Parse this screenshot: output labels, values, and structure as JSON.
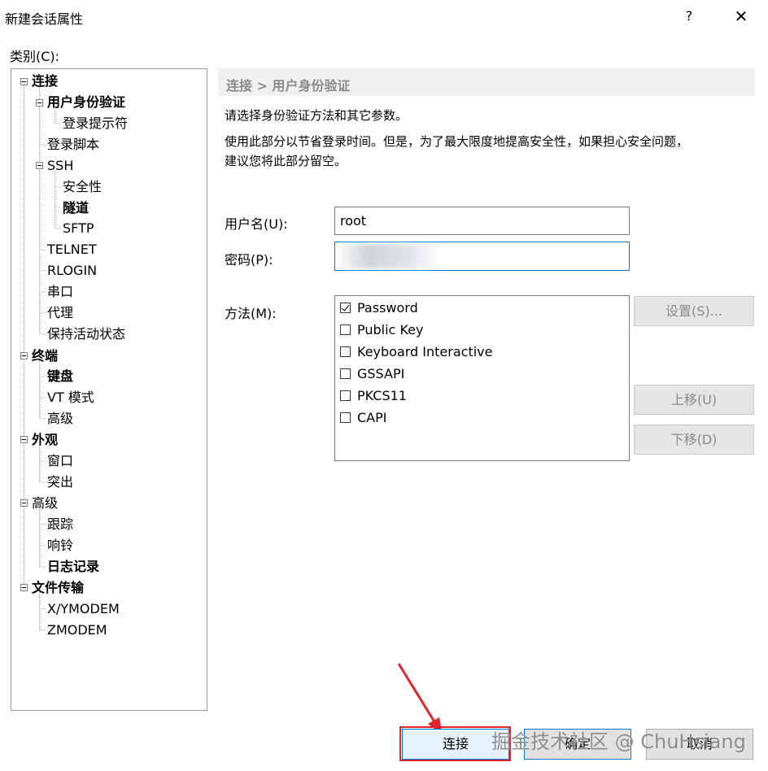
{
  "window": {
    "title": "新建会话属性",
    "help_label": "?",
    "close_label": "✕"
  },
  "category_label": "类别(C):",
  "tree": {
    "items": [
      {
        "label": "连接",
        "bold": true
      },
      {
        "label": "用户身份验证",
        "bold": true
      },
      {
        "label": "登录提示符",
        "bold": false
      },
      {
        "label": "登录脚本",
        "bold": false
      },
      {
        "label": "SSH",
        "bold": false
      },
      {
        "label": "安全性",
        "bold": false
      },
      {
        "label": "隧道",
        "bold": true
      },
      {
        "label": "SFTP",
        "bold": false
      },
      {
        "label": "TELNET",
        "bold": false
      },
      {
        "label": "RLOGIN",
        "bold": false
      },
      {
        "label": "串口",
        "bold": false
      },
      {
        "label": "代理",
        "bold": false
      },
      {
        "label": "保持活动状态",
        "bold": false
      },
      {
        "label": "终端",
        "bold": true
      },
      {
        "label": "键盘",
        "bold": true
      },
      {
        "label": "VT 模式",
        "bold": false
      },
      {
        "label": "高级",
        "bold": false
      },
      {
        "label": "外观",
        "bold": true
      },
      {
        "label": "窗口",
        "bold": false
      },
      {
        "label": "突出",
        "bold": false
      },
      {
        "label": "高级",
        "bold": false
      },
      {
        "label": "跟踪",
        "bold": false
      },
      {
        "label": "响铃",
        "bold": false
      },
      {
        "label": "日志记录",
        "bold": true
      },
      {
        "label": "文件传输",
        "bold": true
      },
      {
        "label": "X/YMODEM",
        "bold": false
      },
      {
        "label": "ZMODEM",
        "bold": false
      }
    ]
  },
  "panel": {
    "breadcrumb": "连接 > 用户身份验证",
    "description_1": "请选择身份验证方法和其它参数。",
    "description_2a": "使用此部分以节省登录时间。但是，为了最大限度地提高安全性，如果担心安全问题，",
    "description_2b": "建议您将此部分留空。",
    "username_label": "用户名(U):",
    "username_value": "root",
    "password_label": "密码(P):",
    "method_label": "方法(M):",
    "methods": [
      {
        "label": "Password",
        "checked": true
      },
      {
        "label": "Public Key",
        "checked": false
      },
      {
        "label": "Keyboard Interactive",
        "checked": false
      },
      {
        "label": "GSSAPI",
        "checked": false
      },
      {
        "label": "PKCS11",
        "checked": false
      },
      {
        "label": "CAPI",
        "checked": false
      }
    ],
    "settings_button": "设置(S)...",
    "move_up_button": "上移(U)",
    "move_down_button": "下移(D)"
  },
  "buttons": {
    "connect": "连接",
    "ok": "确定",
    "cancel": "取消"
  },
  "watermark": "掘金技术社区 @ ChuHsiang",
  "colors": {
    "highlight": "#e0242a",
    "focus": "#0078d7",
    "disabled_text": "#8a8a8a"
  }
}
